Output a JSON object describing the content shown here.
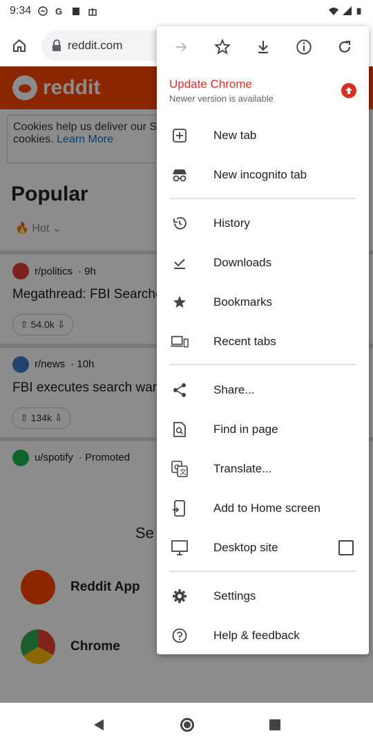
{
  "status": {
    "time": "9:34"
  },
  "browser": {
    "url": "reddit.com"
  },
  "page": {
    "brand": "reddit",
    "cookie_text": "Cookies help us deliver our S",
    "cookie_text2": "cookies.",
    "cookie_link": "Learn More",
    "heading": "Popular",
    "sort": "Hot",
    "posts": [
      {
        "sub": "r/politics",
        "age": "· 9h",
        "title": "Megathread: FBI Searche Donald Trump's Florida H",
        "votes": "54.0k"
      },
      {
        "sub": "r/news",
        "age": "· 10h",
        "title": "FBI executes search warr Lago",
        "votes": "134k"
      },
      {
        "sub": "u/spotify",
        "age": "· Promoted"
      }
    ],
    "sheet_title": "Se",
    "apps": [
      {
        "label": "Reddit App"
      },
      {
        "label": "Chrome"
      }
    ]
  },
  "menu": {
    "update_title": "Update Chrome",
    "update_sub": "Newer version is available",
    "items": [
      {
        "label": "New tab",
        "icon": "plus-box-icon"
      },
      {
        "label": "New incognito tab",
        "icon": "incognito-icon"
      },
      {
        "label": "History",
        "icon": "history-icon"
      },
      {
        "label": "Downloads",
        "icon": "download-done-icon"
      },
      {
        "label": "Bookmarks",
        "icon": "star-icon"
      },
      {
        "label": "Recent tabs",
        "icon": "devices-icon"
      },
      {
        "label": "Share...",
        "icon": "share-icon"
      },
      {
        "label": "Find in page",
        "icon": "find-icon"
      },
      {
        "label": "Translate...",
        "icon": "translate-icon"
      },
      {
        "label": "Add to Home screen",
        "icon": "add-to-home-icon"
      },
      {
        "label": "Desktop site",
        "icon": "desktop-icon",
        "checked": false
      },
      {
        "label": "Settings",
        "icon": "gear-icon"
      },
      {
        "label": "Help & feedback",
        "icon": "help-icon"
      }
    ]
  },
  "colors": {
    "accent_red": "#d93025",
    "reddit_orange": "#ff4500"
  }
}
